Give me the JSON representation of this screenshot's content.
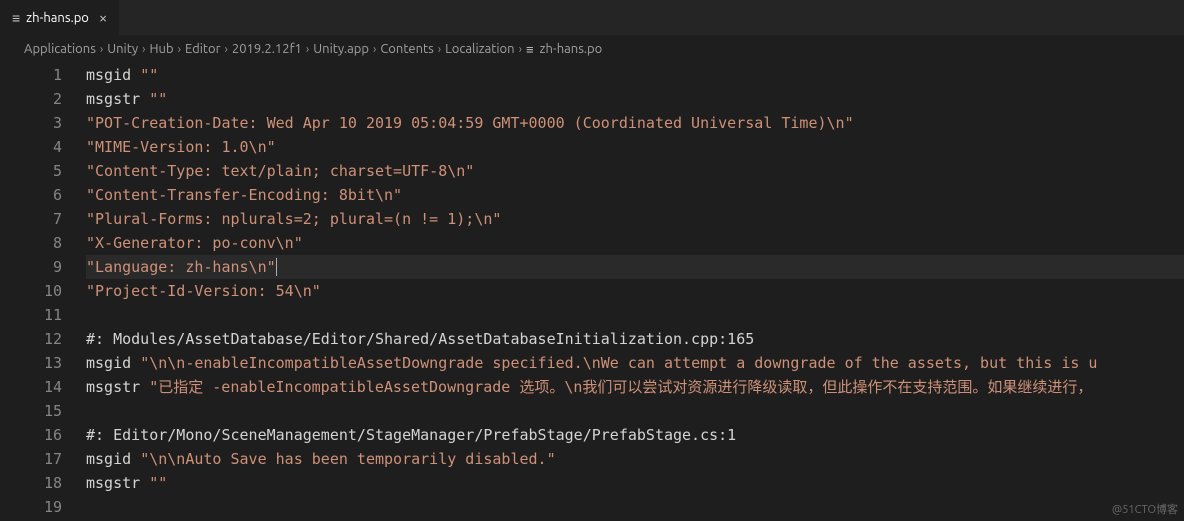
{
  "tab": {
    "filename": "zh-hans.po",
    "icon": "≡",
    "close": "×"
  },
  "breadcrumbs": {
    "items": [
      "Applications",
      "Unity",
      "Hub",
      "Editor",
      "2019.2.12f1",
      "Unity.app",
      "Contents",
      "Localization",
      "zh-hans.po"
    ],
    "sep": "›",
    "file_icon": "≡"
  },
  "editor": {
    "lines": [
      {
        "n": "1",
        "t": "msgid ",
        "s": "\"\""
      },
      {
        "n": "2",
        "t": "msgstr ",
        "s": "\"\""
      },
      {
        "n": "3",
        "t": "",
        "s": "\"POT-Creation-Date: Wed Apr 10 2019 05:04:59 GMT+0000 (Coordinated Universal Time)\\n\""
      },
      {
        "n": "4",
        "t": "",
        "s": "\"MIME-Version: 1.0\\n\""
      },
      {
        "n": "5",
        "t": "",
        "s": "\"Content-Type: text/plain; charset=UTF-8\\n\""
      },
      {
        "n": "6",
        "t": "",
        "s": "\"Content-Transfer-Encoding: 8bit\\n\""
      },
      {
        "n": "7",
        "t": "",
        "s": "\"Plural-Forms: nplurals=2; plural=(n != 1);\\n\""
      },
      {
        "n": "8",
        "t": "",
        "s": "\"X-Generator: po-conv\\n\""
      },
      {
        "n": "9",
        "t": "",
        "s": "\"Language: zh-hans\\n\"",
        "hl": true,
        "cursor": true
      },
      {
        "n": "10",
        "t": "",
        "s": "\"Project-Id-Version: 54\\n\""
      },
      {
        "n": "11",
        "t": "",
        "s": ""
      },
      {
        "n": "12",
        "t": "#: Modules/AssetDatabase/Editor/Shared/AssetDatabaseInitialization.cpp:165",
        "s": ""
      },
      {
        "n": "13",
        "t": "msgid ",
        "s": "\"\\n\\n-enableIncompatibleAssetDowngrade specified.\\nWe can attempt a downgrade of the assets, but this is u"
      },
      {
        "n": "14",
        "t": "msgstr ",
        "s": "\"已指定 -enableIncompatibleAssetDowngrade 选项。\\n我们可以尝试对资源进行降级读取，但此操作不在支持范围。如果继续进行，"
      },
      {
        "n": "15",
        "t": "",
        "s": ""
      },
      {
        "n": "16",
        "t": "#: Editor/Mono/SceneManagement/StageManager/PrefabStage/PrefabStage.cs:1",
        "s": ""
      },
      {
        "n": "17",
        "t": "msgid ",
        "s": "\"\\n\\nAuto Save has been temporarily disabled.\""
      },
      {
        "n": "18",
        "t": "msgstr ",
        "s": "\"\""
      },
      {
        "n": "19",
        "t": "",
        "s": ""
      }
    ]
  },
  "watermark": "@51CTO博客"
}
